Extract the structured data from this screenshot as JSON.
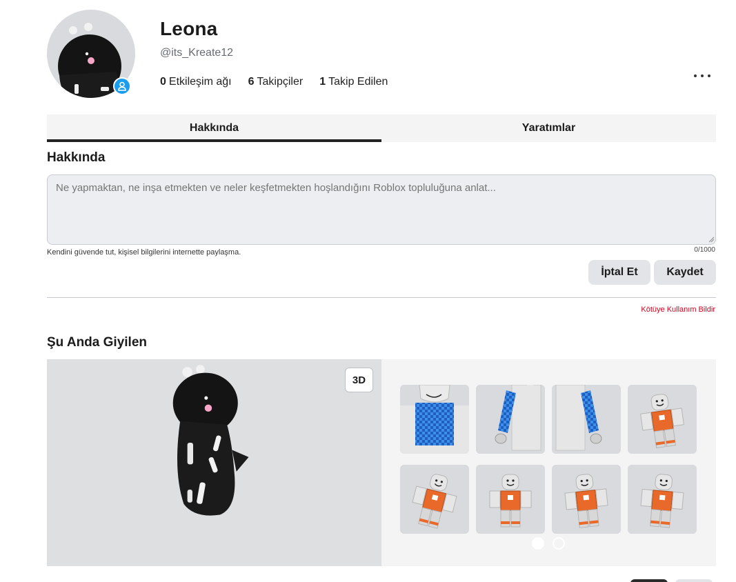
{
  "profile": {
    "display_name": "Leona",
    "username": "@its_Kreate12",
    "stats": [
      {
        "count": "0",
        "label": "Etkileşim ağı"
      },
      {
        "count": "6",
        "label": "Takipçiler"
      },
      {
        "count": "1",
        "label": "Takip Edilen"
      }
    ]
  },
  "tabs": [
    {
      "label": "Hakkında",
      "active": true
    },
    {
      "label": "Yaratımlar",
      "active": false
    }
  ],
  "about": {
    "title": "Hakkında",
    "placeholder": "Ne yapmaktan, ne inşa etmekten ve neler keşfetmekten hoşlandığını Roblox topluluğuna anlat...",
    "safety_note": "Kendini güvende tut, kişisel bilgilerini internette paylaşma.",
    "counter": "0/1000",
    "cancel_label": "İptal Et",
    "save_label": "Kaydet",
    "report_label": "Kötüye Kullanım Bildir"
  },
  "wearing": {
    "title": "Şu Anda Giyilen",
    "toggle_3d_label": "3D",
    "items": [
      {
        "icon": "shirt-checkered-front-icon"
      },
      {
        "icon": "left-arm-checkered-sleeve-icon"
      },
      {
        "icon": "right-arm-checkered-sleeve-icon"
      },
      {
        "icon": "avatar-orange-shirt-pose-icon"
      },
      {
        "icon": "avatar-orange-shirt-run-icon"
      },
      {
        "icon": "avatar-orange-shirt-stand-icon"
      },
      {
        "icon": "avatar-orange-shirt-tpose-icon"
      },
      {
        "icon": "avatar-orange-shirt-walk-icon"
      }
    ],
    "pages": 2,
    "current_page": 1
  },
  "colors": {
    "accent_blue": "#1a9cf0",
    "report_red": "#d0021b",
    "checker_blue": "#2a7de1",
    "shirt_orange": "#e8692a"
  }
}
